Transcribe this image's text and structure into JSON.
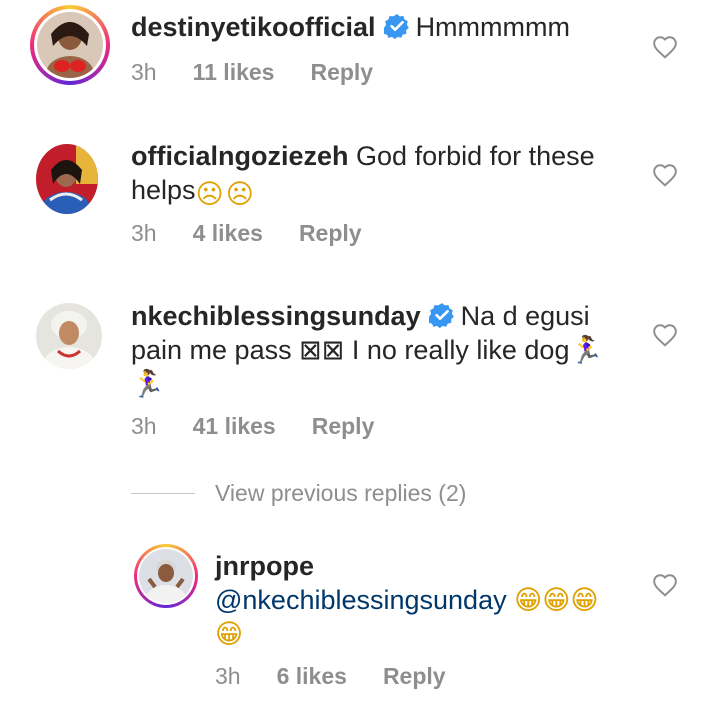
{
  "comments": [
    {
      "username": "destinyetikoofficial",
      "verified": true,
      "text": "Hmmmmmm",
      "time": "3h",
      "likes": "11 likes",
      "reply": "Reply"
    },
    {
      "username": "officialngoziezeh",
      "verified": false,
      "text": " God forbid for these helps",
      "emoji": "☹☹",
      "time": "3h",
      "likes": "4 likes",
      "reply": "Reply"
    },
    {
      "username": "nkechiblessingsunday",
      "verified": true,
      "text_line1": "Na d egusi",
      "text_line2": "pain me pass ⊠⊠ I no really like dog🏃‍♀",
      "text_line3": "🏃‍♀",
      "time": "3h",
      "likes": "41 likes",
      "reply": "Reply"
    }
  ],
  "view_previous_replies": "View previous replies (2)",
  "reply_comment": {
    "username": "jnrpope",
    "mention": "@nkechiblessingsunday",
    "emoji": "😁😁😁",
    "emoji_line2": "😁",
    "time": "3h",
    "likes": "6 likes",
    "reply": "Reply"
  },
  "colors": {
    "text": "#262626",
    "meta": "#8e8e8e",
    "mention": "#00376b",
    "verified": "#3897f0"
  }
}
